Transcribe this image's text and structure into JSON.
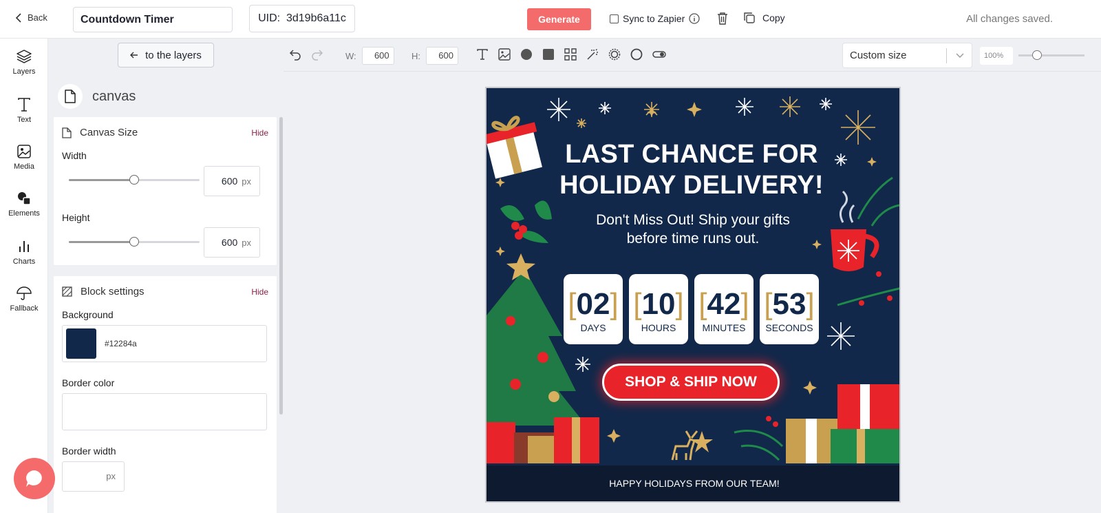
{
  "topbar": {
    "back_label": "Back",
    "title_value": "Countdown Timer",
    "uid_label": "UID:",
    "uid_value": "3d19b6a11c",
    "generate_label": "Generate",
    "sync_label": "Sync to Zapier",
    "copy_label": "Copy",
    "status": "All changes saved."
  },
  "rail": {
    "items": [
      {
        "label": "Layers",
        "icon": "layers-icon"
      },
      {
        "label": "Text",
        "icon": "text-icon"
      },
      {
        "label": "Media",
        "icon": "image-icon"
      },
      {
        "label": "Elements",
        "icon": "shapes-icon"
      },
      {
        "label": "Charts",
        "icon": "bar-chart-icon"
      },
      {
        "label": "Fallback",
        "icon": "umbrella-icon"
      }
    ]
  },
  "panel": {
    "layers_button": "to the layers",
    "object_name": "canvas",
    "canvas_size": {
      "title": "Canvas Size",
      "hide": "Hide",
      "width_label": "Width",
      "width_value": "600",
      "height_label": "Height",
      "height_value": "600",
      "unit": "px"
    },
    "block_settings": {
      "title": "Block settings",
      "hide": "Hide",
      "background_label": "Background",
      "background_value": "#12284a",
      "border_color_label": "Border color",
      "border_width_label": "Border width",
      "border_width_unit": "px"
    }
  },
  "toolbar": {
    "w_label": "W:",
    "w_value": "600",
    "h_label": "H:",
    "h_value": "600",
    "size_preset": "Custom size",
    "zoom": "100%"
  },
  "artwork": {
    "background": "#12284a",
    "headline_1": "LAST CHANCE FOR",
    "headline_2": "HOLIDAY DELIVERY!",
    "sub_1": "Don't Miss Out! Ship your gifts",
    "sub_2": "before time runs out.",
    "countdown": [
      {
        "value": "02",
        "unit": "DAYS"
      },
      {
        "value": "10",
        "unit": "HOURS"
      },
      {
        "value": "42",
        "unit": "MINUTES"
      },
      {
        "value": "53",
        "unit": "SECONDS"
      }
    ],
    "cta": "SHOP & SHIP NOW",
    "footer": "HAPPY HOLIDAYS FROM OUR TEAM!"
  },
  "colors": {
    "accent": "#f36b6b",
    "cta_red": "#e8242a",
    "gold": "#c8a050",
    "hide_link": "#8a2346"
  }
}
